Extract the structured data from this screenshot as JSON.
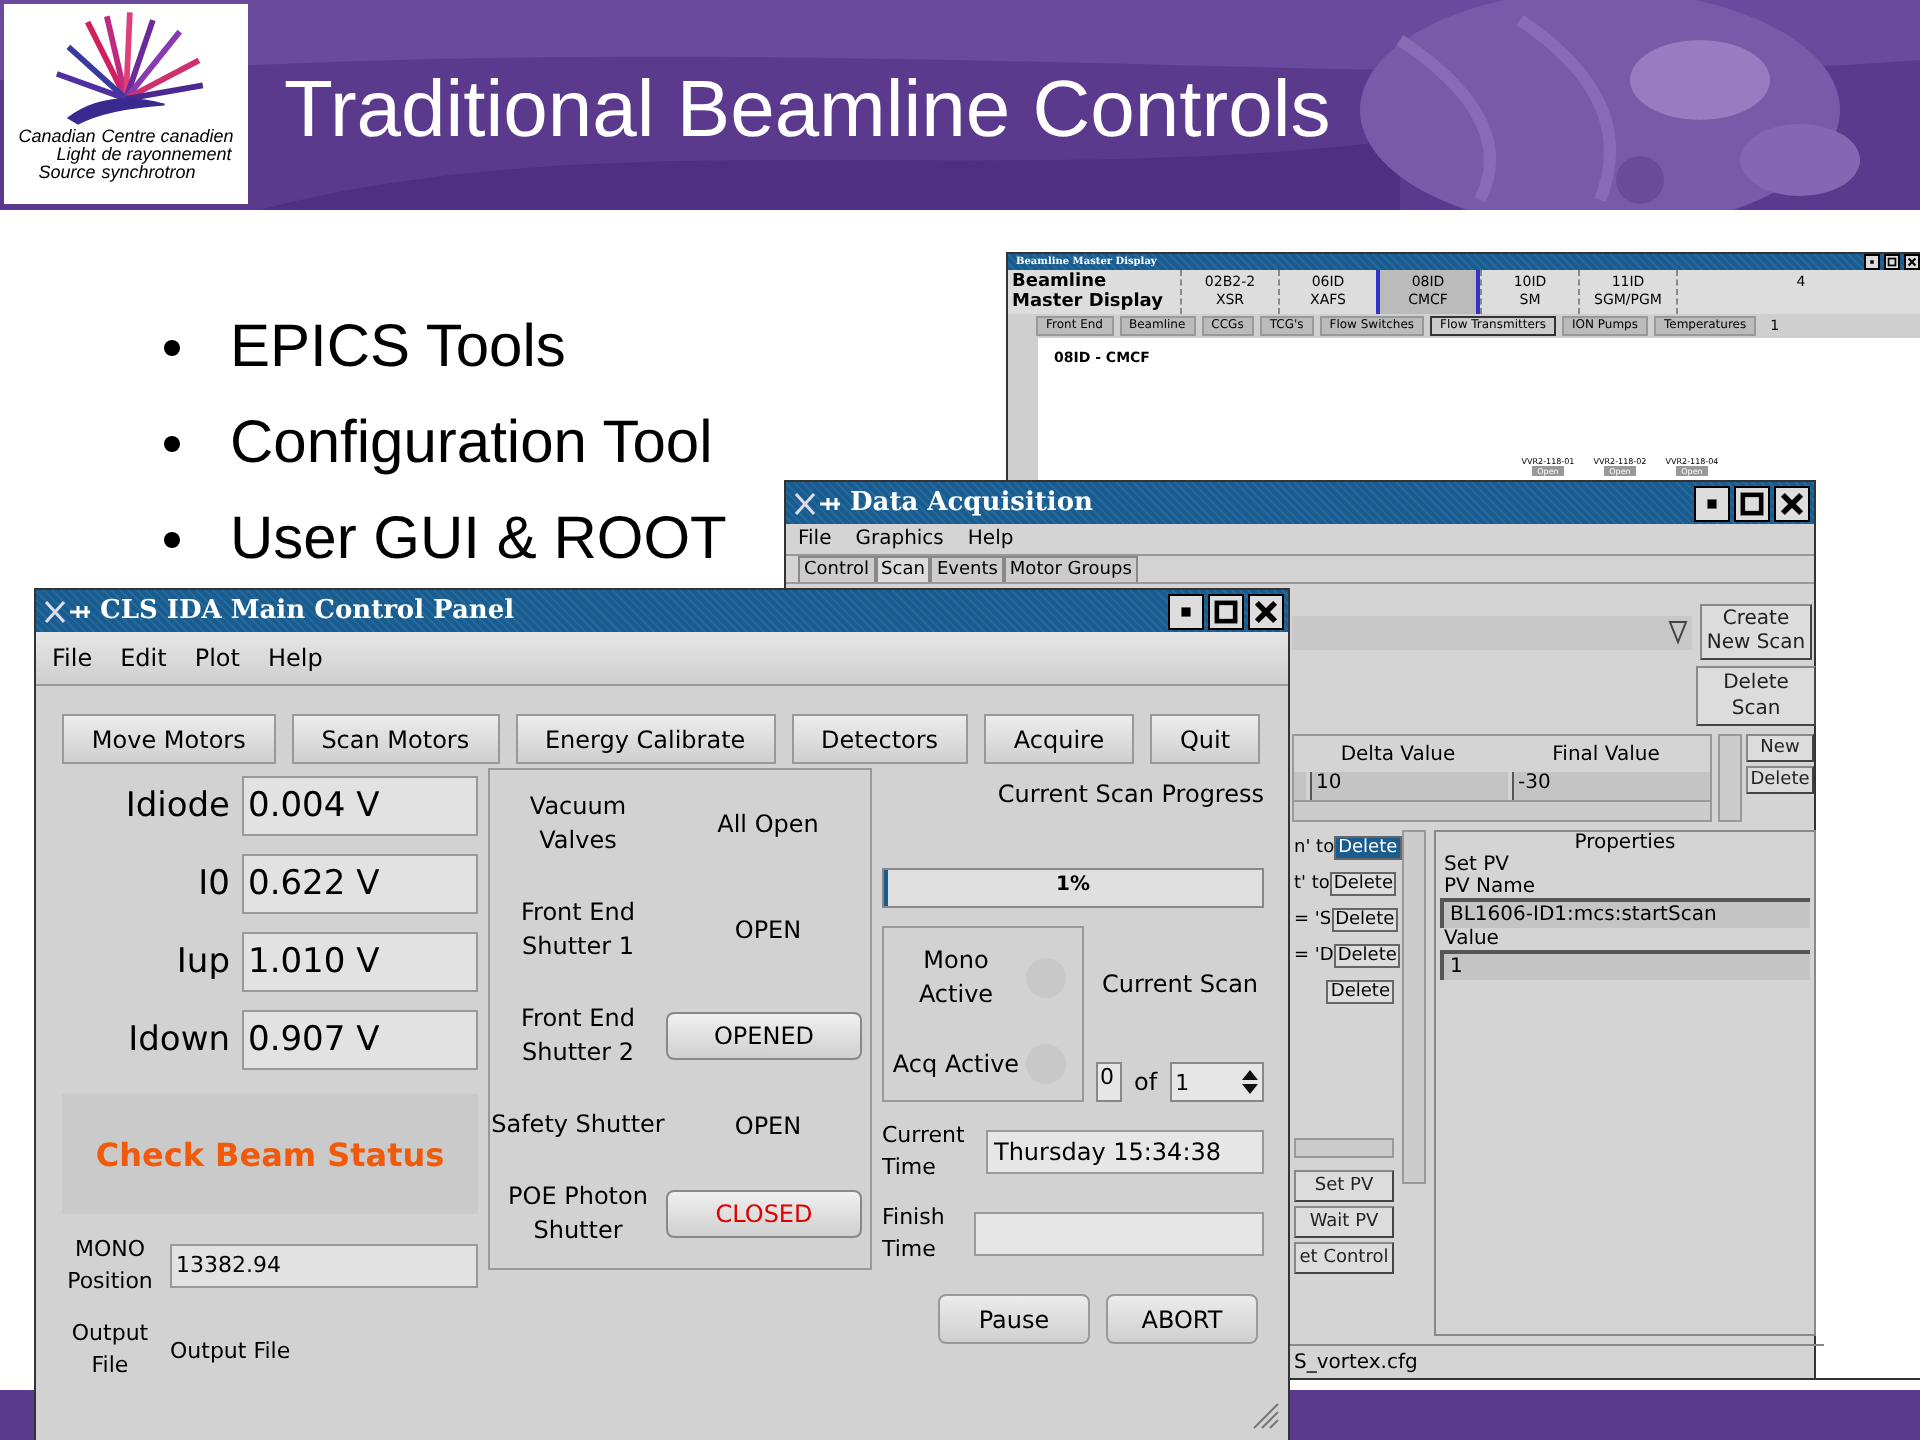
{
  "slide": {
    "title": "Traditional Beamline Controls",
    "logo": {
      "name_en": [
        "Canadian",
        "Light",
        "Source"
      ],
      "name_fr": [
        "Centre canadien",
        "de rayonnement",
        "synchrotron"
      ]
    },
    "bullets": [
      "EPICS Tools",
      "Configuration Tool",
      "User GUI & ROOT"
    ]
  },
  "beamline_window": {
    "title": "Beamline Master Display",
    "heading": "Beamline Master Display",
    "beamlines": [
      {
        "code": "02B2-2",
        "label": "XSR",
        "selected": false
      },
      {
        "code": "06ID",
        "label": "XAFS",
        "selected": false
      },
      {
        "code": "08ID",
        "label": "CMCF",
        "selected": true
      },
      {
        "code": "10ID",
        "label": "SM",
        "selected": false
      },
      {
        "code": "11ID",
        "label": "SGM/PGM",
        "selected": false
      }
    ],
    "page_count": "4",
    "tabs": [
      {
        "label": "Front End",
        "selected": false
      },
      {
        "label": "Beamline",
        "selected": false
      },
      {
        "label": "CCGs",
        "selected": false
      },
      {
        "label": "TCG's",
        "selected": false
      },
      {
        "label": "Flow Switches",
        "selected": false
      },
      {
        "label": "Flow Transmitters",
        "selected": true
      },
      {
        "label": "ION Pumps",
        "selected": false
      },
      {
        "label": "Temperatures",
        "selected": false
      }
    ],
    "tab_page": "1",
    "section": "08ID - CMCF",
    "valves": [
      {
        "name": "VVR2-118-01",
        "state": "Open"
      },
      {
        "name": "VVR2-118-02",
        "state": "Open"
      },
      {
        "name": "VVR2-118-04",
        "state": "Open"
      }
    ]
  },
  "acquisition_window": {
    "title": "Data Acquisition",
    "menu": [
      "File",
      "Graphics",
      "Help"
    ],
    "tabs": [
      {
        "label": "Control",
        "selected": false
      },
      {
        "label": "Scan",
        "selected": true
      },
      {
        "label": "Events",
        "selected": false
      },
      {
        "label": "Motor Groups",
        "selected": false
      }
    ],
    "create_button": "Create New Scan",
    "delete_scan_button": "Delete Scan",
    "columns": [
      "Delta Value",
      "Final Value"
    ],
    "delta": "10",
    "final": "-30",
    "new_button": "New",
    "delete_button": "Delete",
    "actions": [
      {
        "text": "n' to",
        "button": "Delete",
        "selected": true
      },
      {
        "text": "t' to",
        "button": "Delete",
        "selected": false
      },
      {
        "text": "= 'S",
        "button": "Delete",
        "selected": false
      },
      {
        "text": "= 'D",
        "button": "Delete",
        "selected": false
      },
      {
        "button": "Delete",
        "selected": false
      }
    ],
    "properties": {
      "title": "Properties",
      "type": "Set PV",
      "pv_label": "PV Name",
      "pv": "BL1606-ID1:mcs:startScan",
      "value_label": "Value",
      "value": "1"
    },
    "add_buttons": [
      "Set PV",
      "Wait PV",
      "et Control"
    ],
    "status": "S_vortex.cfg"
  },
  "main_window": {
    "title": "CLS IDA Main Control Panel",
    "menu": [
      "File",
      "Edit",
      "Plot",
      "Help"
    ],
    "buttons": [
      "Move Motors",
      "Scan Motors",
      "Energy Calibrate",
      "Detectors",
      "Acquire",
      "Quit"
    ],
    "readings": [
      {
        "label": "Idiode",
        "value": "0.004 V"
      },
      {
        "label": "I0",
        "value": "0.622 V"
      },
      {
        "label": "Iup",
        "value": "1.010 V"
      },
      {
        "label": "Idown",
        "value": "0.907 V"
      }
    ],
    "beam_status": "Check Beam Status",
    "mono": {
      "label": "MONO Position",
      "value": "13382.94"
    },
    "output": {
      "label": "Output File",
      "value": "Output File"
    },
    "shutters": [
      {
        "label": "Vacuum Valves",
        "state": "All Open",
        "kind": "text",
        "alarm": false
      },
      {
        "label": "Front End Shutter 1",
        "state": "OPEN",
        "kind": "text",
        "alarm": false
      },
      {
        "label": "Front End Shutter 2",
        "state": "OPENED",
        "kind": "button",
        "alarm": false
      },
      {
        "label": "Safety Shutter",
        "state": "OPEN",
        "kind": "text",
        "alarm": false
      },
      {
        "label": "POE Photon Shutter",
        "state": "CLOSED",
        "kind": "button",
        "alarm": true
      }
    ],
    "progress": {
      "title": "Current Scan Progress",
      "level": 0.01,
      "reading": "1%"
    },
    "indicators": [
      {
        "label": "Mono Active",
        "on": false
      },
      {
        "label": "Acq Active",
        "on": false
      }
    ],
    "current_scan": {
      "label": "Current Scan",
      "index": "0",
      "of": "of",
      "total": "1"
    },
    "current_time": {
      "label": "Current Time",
      "value": "Thursday 15:34:38"
    },
    "finish_time": {
      "label": "Finish Time"
    },
    "pause": "Pause",
    "abort": "ABORT"
  }
}
